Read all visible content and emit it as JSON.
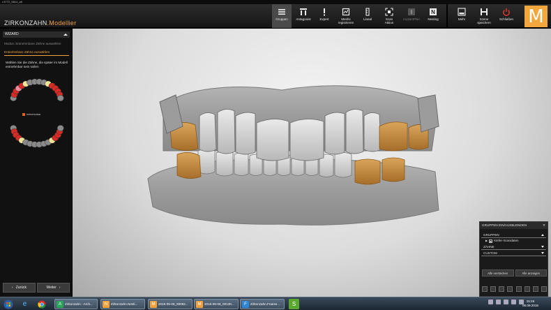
{
  "window": {
    "title": "r.5772_5814_alt"
  },
  "brand": {
    "primary": "ZIRKONZAHN",
    "secondary": ".Modellier"
  },
  "toolbar": {
    "tools": [
      {
        "id": "gruppen",
        "label": "Gruppen",
        "icon": "menu-icon",
        "active": true
      },
      {
        "id": "antagonist",
        "label": "Antagonist",
        "icon": "antagonist-icon"
      },
      {
        "id": "expert",
        "label": "Expert",
        "icon": "exclamation-icon"
      },
      {
        "id": "mesh",
        "label": "Meshs\nregistrieren",
        "icon": "mesh-register-icon"
      },
      {
        "id": "lineal",
        "label": "Lineal",
        "icon": "ruler-icon"
      },
      {
        "id": "scan",
        "label": "Scan\nAktion",
        "icon": "scan-icon"
      },
      {
        "id": "implant",
        "label": "ImplantPlan",
        "icon": "implant-icon",
        "disabled": true
      },
      {
        "id": "nesting",
        "label": "Nesting",
        "icon": "nesting-icon"
      }
    ],
    "right_tools": [
      {
        "id": "mehr",
        "label": "Mehr",
        "icon": "more-icon"
      },
      {
        "id": "speichern",
        "label": "Szene\nspeichern",
        "icon": "save-icon"
      },
      {
        "id": "schliessen",
        "label": "Schließen",
        "icon": "power-icon"
      }
    ],
    "logo_letter": "M"
  },
  "wizard": {
    "header": "WIZARD",
    "step1": "Modus: Entnehmbare Zähne auswählen",
    "step2": "Entnehmbare Zähne auswählen",
    "instruction": "Wählen Sie die Zähne, die später im Modell entnehmbar sein sollen",
    "legend": "entnehmbar",
    "back_label": "Zurück",
    "next_label": "Weiter"
  },
  "groups": {
    "header": "GRUPPEN EIN/AUSBLENDEN",
    "close": "✕",
    "section_groups": "GRUPPEN",
    "item": "Kiefer-Scandaten",
    "section_teeth": "ZÄHNE",
    "section_custom": "CUSTOM",
    "hide_all": "Alle verstecken",
    "show_all": "Alle anzeigen"
  },
  "taskbar": {
    "tasks": [
      {
        "label": "Zirkonzahn - Arch...",
        "color": "#2aa55a",
        "letter": "A"
      },
      {
        "label": "Zirkonzahn.Nesti...",
        "color": "#f2a23a",
        "letter": "N"
      },
      {
        "label": "2016-09-06_00082...",
        "color": "#f2a23a",
        "letter": "M"
      },
      {
        "label": "2016-09-06_00130...",
        "color": "#f2a23a",
        "letter": "M"
      },
      {
        "label": "Zirkonzahn.Fraese...",
        "color": "#2e86d6",
        "letter": "F"
      }
    ],
    "clock_time": "15:25",
    "clock_date": "06.09.2016"
  },
  "colors": {
    "accent": "#f2a23a",
    "removable": "#e0631f",
    "tooth_red": "#d62a24",
    "tooth_pink": "#f08a9a",
    "tooth_yellow": "#f2e49a",
    "tooth_gray": "#8a8a8a"
  }
}
